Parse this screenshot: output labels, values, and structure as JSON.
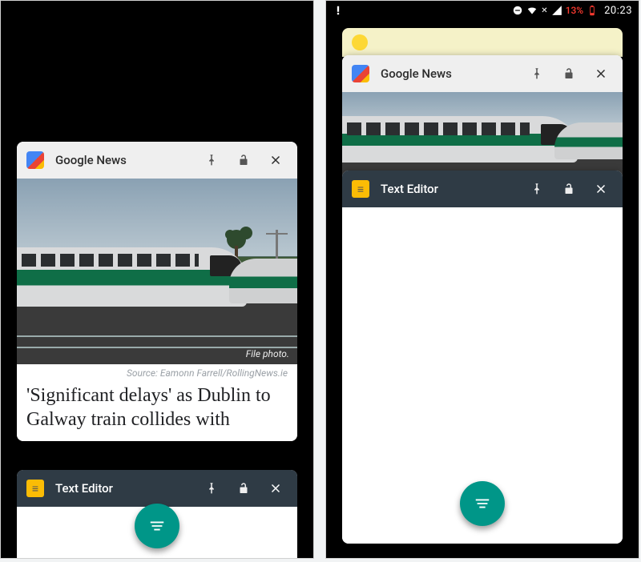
{
  "statusbar": {
    "battery_pct": "13%",
    "clock": "20:23",
    "dnd_icon": "do-not-disturb",
    "wifi_icon": "wifi",
    "signal_icon": "cellular",
    "batt_icon": "battery-low",
    "priority_icon": "priority"
  },
  "left": {
    "news": {
      "app_title": "Google News",
      "img_caption": "File photo.",
      "source_line": "Source: Eamonn Farrell/RollingNews.ie",
      "headline": "'Significant delays' as Dublin to Galway train collides with"
    },
    "editor": {
      "app_title": "Text Editor"
    }
  },
  "right": {
    "news": {
      "app_title": "Google News"
    },
    "editor": {
      "app_title": "Text Editor"
    }
  },
  "actions": {
    "pin": "pin",
    "lock": "unlock",
    "close": "close",
    "fab": "sort-lines"
  }
}
